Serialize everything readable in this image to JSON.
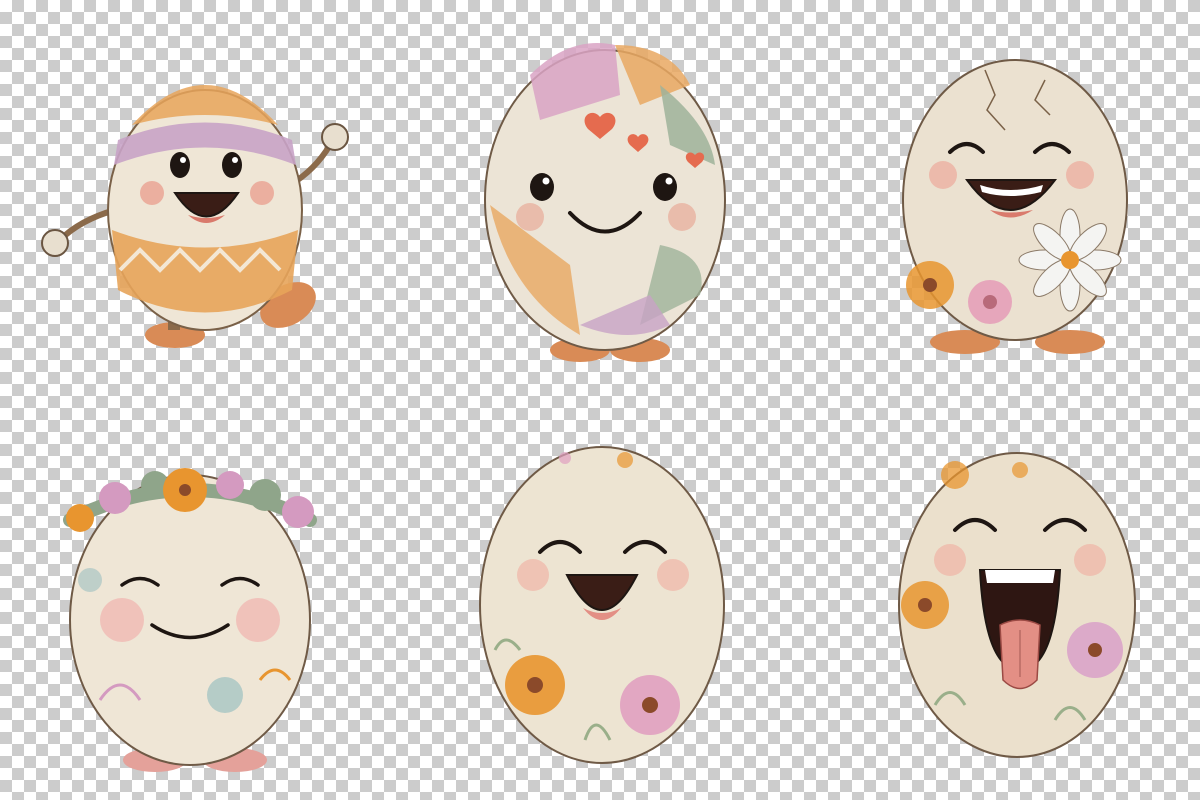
{
  "image": {
    "background": "transparency-checkerboard",
    "checker_colors": [
      "#ffffff",
      "#cccccc"
    ]
  },
  "eggs": [
    {
      "name": "patterned-egg-waving",
      "expression": "smile-open",
      "colors": {
        "shell": "#efe6d6",
        "band1": "#c8a3c6",
        "band2": "#e7a45a",
        "cheek": "#e88a7a",
        "feet": "#d98b56"
      }
    },
    {
      "name": "patchwork-heart-egg",
      "expression": "smile",
      "colors": {
        "shell": "#ece4d6",
        "patch1": "#d9a3c4",
        "patch2": "#e9a862",
        "patch3": "#9fb39a",
        "cheek": "#e89a88",
        "feet": "#d98b56"
      }
    },
    {
      "name": "cracked-daisy-egg",
      "expression": "grin-closed-eyes",
      "colors": {
        "shell": "#ebe1d0",
        "flower1": "#f2f2f2",
        "flower2": "#e6a0b8",
        "flower3": "#e8952f",
        "cheek": "#ec9a8c",
        "feet": "#d98b56"
      }
    },
    {
      "name": "flower-crown-egg",
      "expression": "calm-smile",
      "colors": {
        "shell": "#efe6d6",
        "crown1": "#e8952f",
        "crown2": "#d49ac0",
        "leaf": "#8fa58a",
        "cheek": "#f0a4a4",
        "feet": "#e4a19a"
      }
    },
    {
      "name": "floral-laughing-egg",
      "expression": "laugh",
      "colors": {
        "shell": "#ede4d2",
        "flower1": "#e8952f",
        "flower2": "#e0a0c0",
        "leaf": "#9aaf8a",
        "cheek": "#f0a89a"
      }
    },
    {
      "name": "tongue-out-floral-egg",
      "expression": "tongue-out",
      "colors": {
        "shell": "#ebe0cc",
        "flower1": "#e8952f",
        "flower2": "#d9a0c8",
        "leaf": "#9aaf8a",
        "cheek": "#f0a89a"
      }
    }
  ]
}
